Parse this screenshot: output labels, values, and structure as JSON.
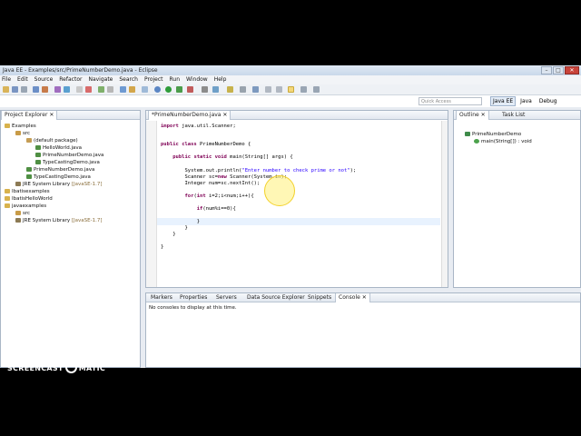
{
  "window": {
    "title": "Java EE - Examples/src/PrimeNumberDemo.java - Eclipse",
    "controls": [
      "–",
      "□",
      "✕"
    ]
  },
  "menu": [
    "File",
    "Edit",
    "Source",
    "Refactor",
    "Navigate",
    "Search",
    "Project",
    "Run",
    "Window",
    "Help"
  ],
  "quick_access": {
    "placeholder": "Quick Access"
  },
  "perspectives": [
    {
      "label": "Java EE",
      "active": true
    },
    {
      "label": "Java",
      "active": false
    },
    {
      "label": "Debug",
      "active": false
    }
  ],
  "project_explorer": {
    "tab_label": "Project Explorer",
    "tree": [
      {
        "label": "Examples",
        "depth": 0,
        "icon": "project-icon"
      },
      {
        "label": "src",
        "depth": 1,
        "icon": "source-folder-icon"
      },
      {
        "label": "(default package)",
        "depth": 2,
        "icon": "package-icon"
      },
      {
        "label": "HelloWorld.java",
        "depth": 3,
        "icon": "java-file-icon"
      },
      {
        "label": "PrimeNumberDemo.java",
        "depth": 3,
        "icon": "java-file-icon"
      },
      {
        "label": "TypeCastingDemo.java",
        "depth": 3,
        "icon": "java-file-icon"
      },
      {
        "label": "PrimeNumberDemo.java",
        "depth": 2,
        "icon": "java-file-icon"
      },
      {
        "label": "TypeCastingDemo.java",
        "depth": 2,
        "icon": "java-file-icon"
      },
      {
        "label": "JRE System Library",
        "lib": "[JavaSE-1.7]",
        "depth": 1,
        "icon": "library-icon"
      },
      {
        "label": "Ibatisexamples",
        "depth": 0,
        "icon": "project-icon"
      },
      {
        "label": "IbatisHelloWorld",
        "depth": 0,
        "icon": "project-icon"
      },
      {
        "label": "javaexamples",
        "depth": 0,
        "icon": "project-icon"
      },
      {
        "label": "src",
        "depth": 1,
        "icon": "source-folder-icon"
      },
      {
        "label": "JRE System Library",
        "lib": "[JavaSE-1.7]",
        "depth": 1,
        "icon": "library-icon"
      }
    ]
  },
  "editor": {
    "tab_label": "*PrimeNumberDemo.java",
    "lines": [
      "import java.util.Scanner;",
      "",
      "public class PrimeNumberDemo {",
      "",
      "    public static void main(String[] args) {",
      "",
      "        System.out.println(\"Enter number to check prime or not\");",
      "        Scanner sc=new Scanner(System.in);",
      "        Integer num=sc.nextInt();",
      "",
      "        for(int i=2;i<num;i++){",
      "",
      "            if(num%i==0){",
      "",
      "            }",
      "        }",
      "    }",
      "",
      "}"
    ]
  },
  "outline": {
    "tabs": [
      "Outline",
      "Task List"
    ],
    "items": [
      {
        "label": "PrimeNumberDemo",
        "depth": 0,
        "icon": "class-icon"
      },
      {
        "label": "main(String[]) : void",
        "depth": 1,
        "icon": "method-icon"
      }
    ]
  },
  "bottom_panel": {
    "tabs": [
      "Markers",
      "Properties",
      "Servers",
      "Data Source Explorer",
      "Snippets",
      "Console"
    ],
    "active_tab": "Console",
    "message": "No consoles to display at this time."
  },
  "watermark": {
    "recorded_with": "RECORDED WITH",
    "brand_left": "SCREENCAST",
    "brand_right": "MATIC"
  },
  "colors": {
    "keyword": "#7f0055",
    "string": "#2a00ff",
    "accent": "#3a76c4"
  }
}
